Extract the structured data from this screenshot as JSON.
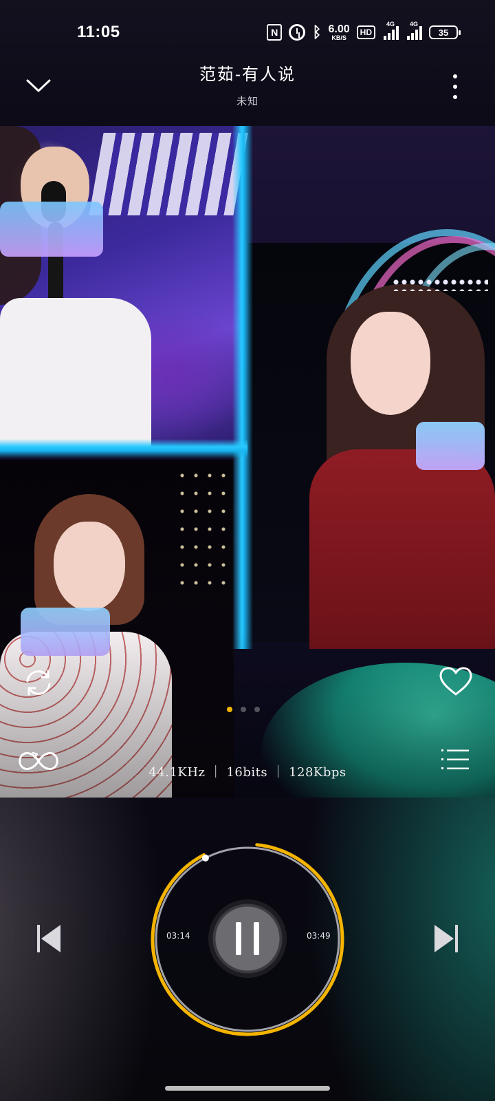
{
  "status_bar": {
    "time": "11:05",
    "nfc": "N",
    "net_speed_value": "6.00",
    "net_speed_unit": "KB/S",
    "hd": "HD",
    "signal1_label": "4G",
    "signal2_label": "4G",
    "battery": "35",
    "icons": [
      "nfc-icon",
      "alarm-icon",
      "bluetooth-icon",
      "hd-voice-icon",
      "signal-icon",
      "signal-icon",
      "battery-icon"
    ]
  },
  "header": {
    "title": "范茹-有人说",
    "artist": "未知",
    "collapse_icon": "chevron-down-icon",
    "more_icon": "more-vertical-icon"
  },
  "player": {
    "audio_info": "44.1KHz ｜ 16bits ｜ 128Kbps",
    "elapsed": "03:14",
    "total": "03:49",
    "progress_fraction": 0.924,
    "liked": false,
    "page_count": 3,
    "active_page": 0,
    "controls": {
      "refresh_icon": "refresh-icon",
      "like_icon": "heart-icon",
      "loop_icon": "loop-icon",
      "queue_icon": "playlist-icon",
      "prev_icon": "skip-previous-icon",
      "next_icon": "skip-next-icon",
      "pause_icon": "pause-icon"
    }
  },
  "colors": {
    "accent": "#F4B400",
    "progress_track": "#BDBDC4"
  }
}
